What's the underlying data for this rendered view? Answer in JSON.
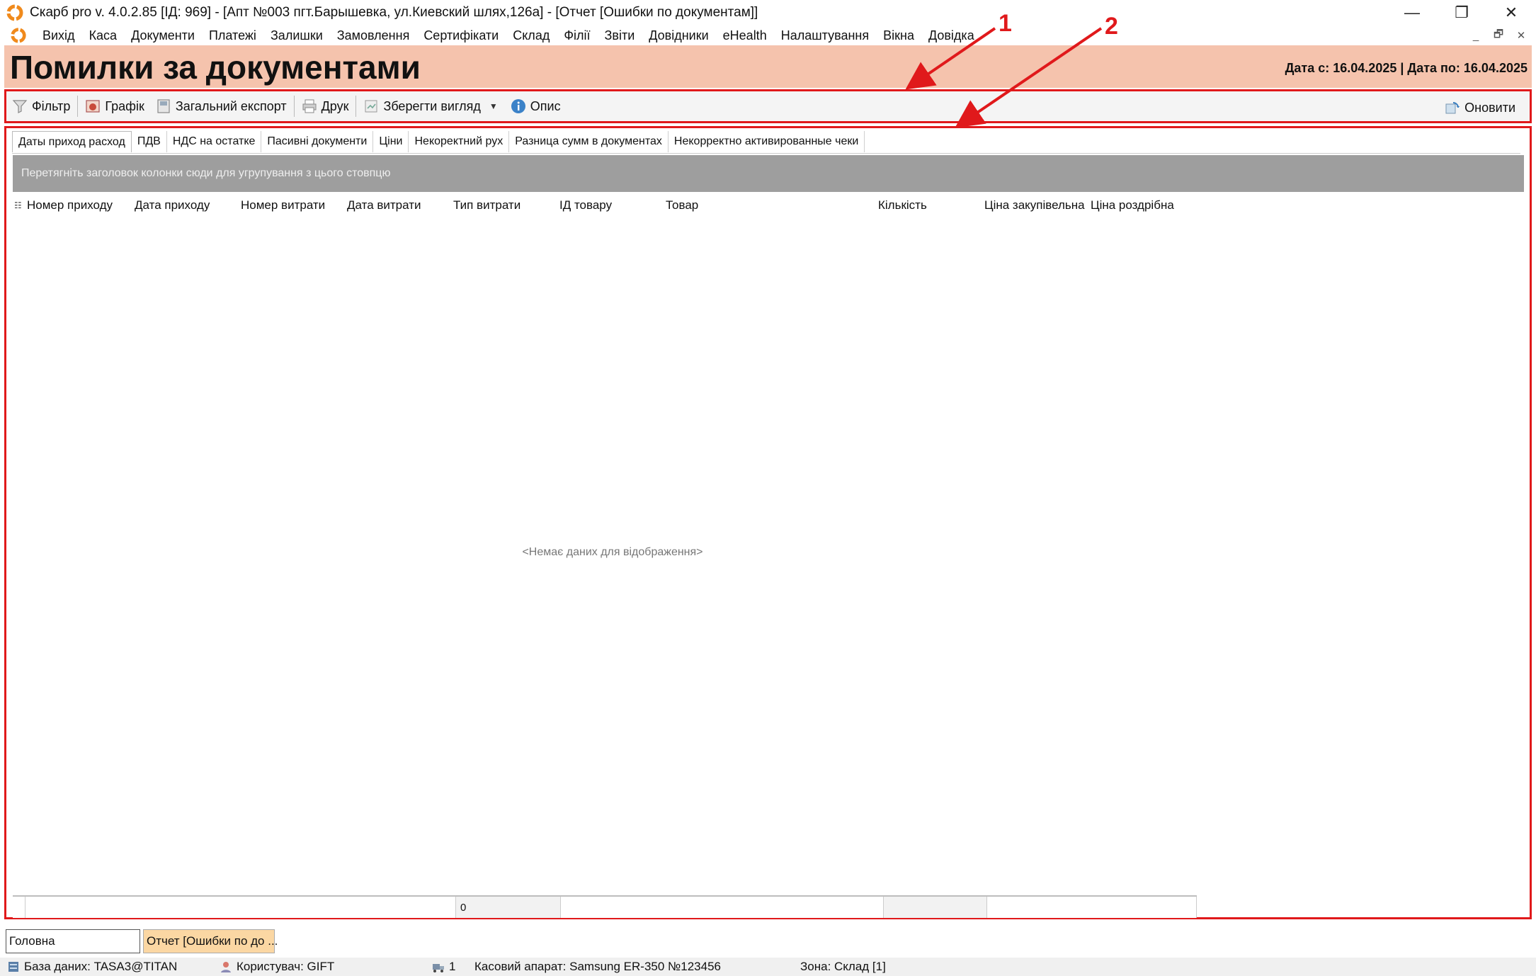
{
  "window": {
    "title": "Скарб pro v. 4.0.2.85 [ІД: 969] - [Апт №003 пгт.Барышевка, ул.Киевский шлях,126а] - [Отчет [Ошибки по документам]]",
    "minimize": "—",
    "restore": "❐",
    "close": "✕"
  },
  "menu": {
    "items": [
      "Вихід",
      "Каса",
      "Документи",
      "Платежі",
      "Залишки",
      "Замовлення",
      "Сертифікати",
      "Склад",
      "Філії",
      "Звіти",
      "Довідники",
      "eHealth",
      "Налаштування",
      "Вікна",
      "Довідка"
    ],
    "mdi_min": "_",
    "mdi_restore": "🗗",
    "mdi_close": "✕"
  },
  "header": {
    "title": "Помилки за документами",
    "date_range": "Дата с: 16.04.2025 | Дата по: 16.04.2025"
  },
  "toolbar": {
    "filter": "Фільтр",
    "chart": "Графік",
    "export": "Загальний експорт",
    "print": "Друк",
    "save_view": "Зберегти вигляд",
    "description": "Опис",
    "refresh": "Оновити"
  },
  "tabs": [
    "Даты приход расход",
    "ПДВ",
    "НДС на остатке",
    "Пасивні документи",
    "Ціни",
    "Некоректний рух",
    "Разница сумм в документах",
    "Некорректно активированные чеки"
  ],
  "grid": {
    "group_hint": "Перетягніть заголовок колонки сюди для угрупування з цього стовпцю",
    "columns": [
      "Номер приходу",
      "Дата приходу",
      "Номер витрати",
      "Дата витрати",
      "Тип витрати",
      "ІД товару",
      "Товар",
      "Кількість",
      "Ціна закупівельна",
      "Ціна роздрібна"
    ],
    "empty": "<Немає даних для відображення>",
    "footer_count": "0"
  },
  "doc_tabs": [
    "Головна",
    "Отчет [Ошибки по до ..."
  ],
  "status": {
    "db": "База даних: TASA3@TITAN",
    "user": "Користувач: GIFT",
    "count": "1",
    "cash": "Касовий апарат: Samsung ER-350 №123456",
    "zone": "Зона: Склад [1]"
  },
  "annotations": [
    "1",
    "2"
  ],
  "colors": {
    "accent_red": "#e0191b",
    "header_band": "#f5c3ad",
    "group_bar": "#9e9e9e"
  }
}
